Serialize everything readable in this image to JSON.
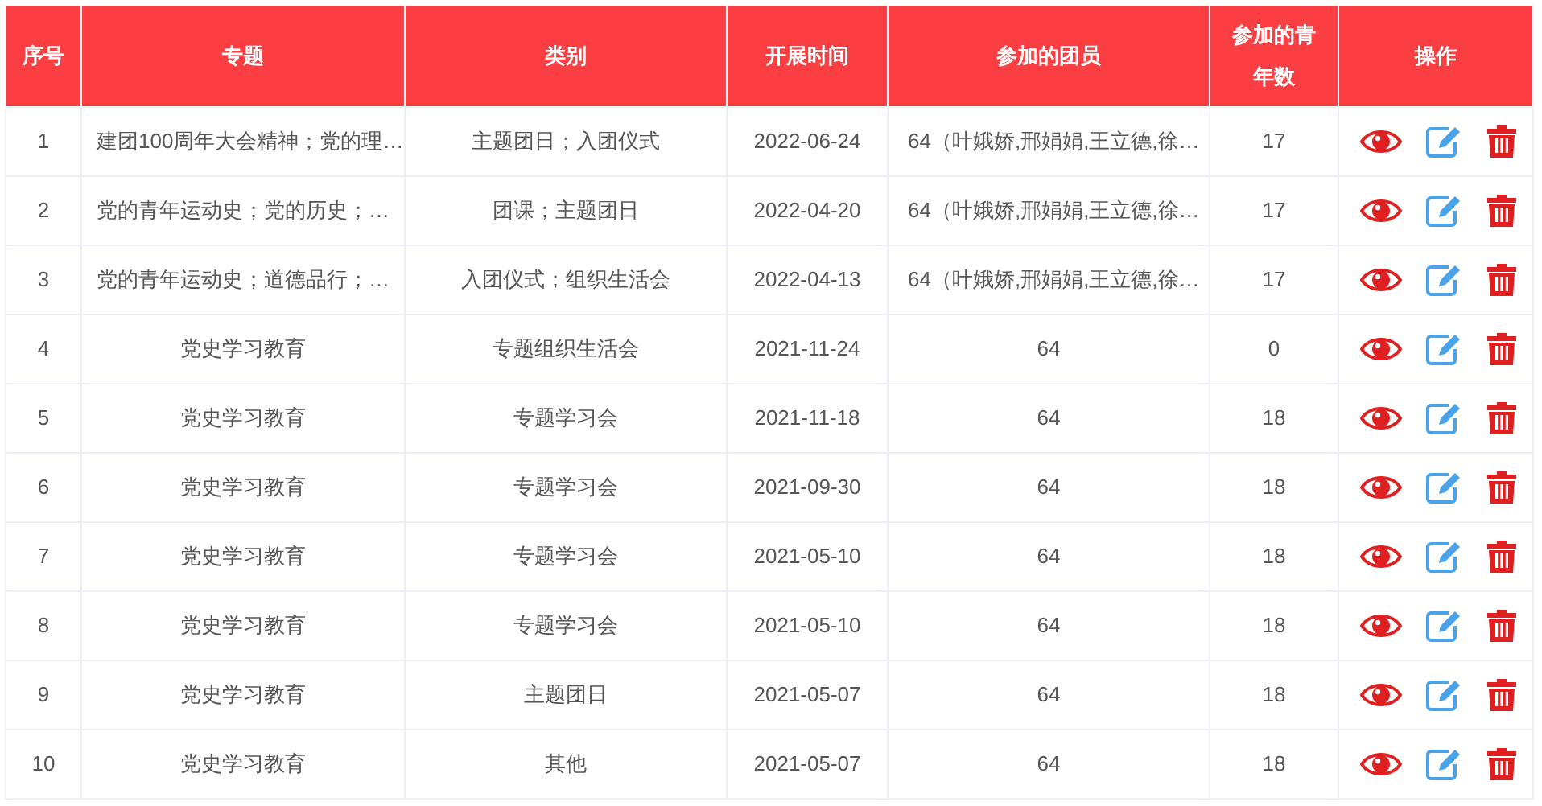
{
  "table": {
    "columns": [
      "序号",
      "专题",
      "类别",
      "开展时间",
      "参加的团员",
      "参加的青年数",
      "操作"
    ],
    "rows": [
      {
        "kind": "truncated",
        "cells": [
          "1",
          "建团100周年大会精神；党的理…",
          "主题团日；入团仪式",
          "2022-06-24",
          "64（叶娥娇,邢娟娟,王立德,徐…",
          "17"
        ]
      },
      {
        "kind": "truncated",
        "cells": [
          "2",
          "党的青年运动史；党的历史；…",
          "团课；主题团日",
          "2022-04-20",
          "64（叶娥娇,邢娟娟,王立德,徐…",
          "17"
        ]
      },
      {
        "kind": "truncated",
        "cells": [
          "3",
          "党的青年运动史；道德品行；…",
          "入团仪式；组织生活会",
          "2022-04-13",
          "64（叶娥娇,邢娟娟,王立德,徐…",
          "17"
        ]
      },
      {
        "kind": "plain",
        "cells": [
          "4",
          "党史学习教育",
          "专题组织生活会",
          "2021-11-24",
          "64",
          "0"
        ]
      },
      {
        "kind": "plain",
        "cells": [
          "5",
          "党史学习教育",
          "专题学习会",
          "2021-11-18",
          "64",
          "18"
        ]
      },
      {
        "kind": "plain",
        "cells": [
          "6",
          "党史学习教育",
          "专题学习会",
          "2021-09-30",
          "64",
          "18"
        ]
      },
      {
        "kind": "plain",
        "cells": [
          "7",
          "党史学习教育",
          "专题学习会",
          "2021-05-10",
          "64",
          "18"
        ]
      },
      {
        "kind": "plain",
        "cells": [
          "8",
          "党史学习教育",
          "专题学习会",
          "2021-05-10",
          "64",
          "18"
        ]
      },
      {
        "kind": "plain",
        "cells": [
          "9",
          "党史学习教育",
          "主题团日",
          "2021-05-07",
          "64",
          "18"
        ]
      },
      {
        "kind": "plain",
        "cells": [
          "10",
          "党史学习教育",
          "其他",
          "2021-05-07",
          "64",
          "18"
        ]
      }
    ]
  }
}
